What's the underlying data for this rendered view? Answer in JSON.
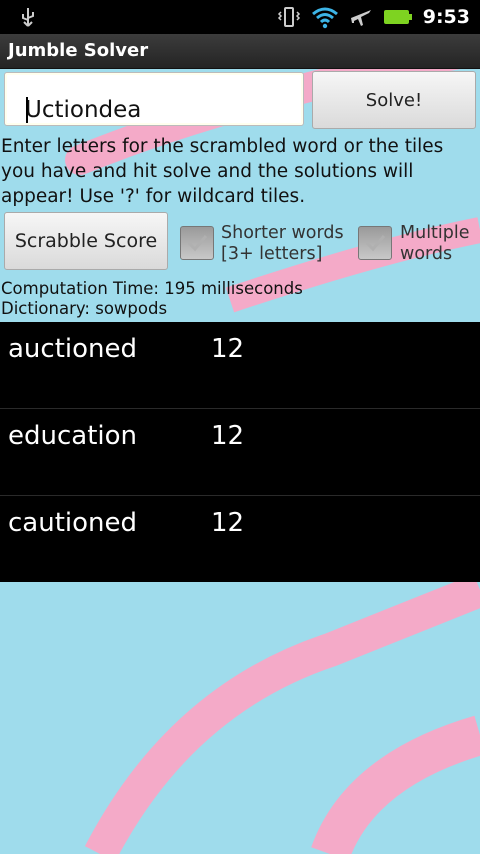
{
  "status_bar": {
    "time": "9:53",
    "icons": [
      "usb-icon",
      "vibrate-icon",
      "wifi-icon",
      "airplane-icon",
      "battery-icon"
    ]
  },
  "app": {
    "title": "Jumble Solver"
  },
  "form": {
    "input_value": "Uctiondea",
    "solve_label": "Solve!",
    "instructions": "Enter letters for the scrambled word or the tiles you have and hit solve and the solutions will appear! Use '?' for wildcard tiles.",
    "scrabble_label": "Scrabble Score",
    "shorter_words_label_1": "Shorter words",
    "shorter_words_label_2": "[3+ letters]",
    "shorter_words_checked": true,
    "multiple_words_label_1": "Multiple",
    "multiple_words_label_2": "words",
    "multiple_words_checked": true
  },
  "info": {
    "computation": "Computation Time: 195 milliseconds",
    "dictionary": "Dictionary: sowpods"
  },
  "results": [
    {
      "word": "auctioned",
      "score": "12"
    },
    {
      "word": "education",
      "score": "12"
    },
    {
      "word": "cautioned",
      "score": "12"
    }
  ],
  "colors": {
    "background": "#9fdcec",
    "decor_pink": "#f4aac8",
    "results_bg": "#000000",
    "battery_green": "#7ed321"
  }
}
